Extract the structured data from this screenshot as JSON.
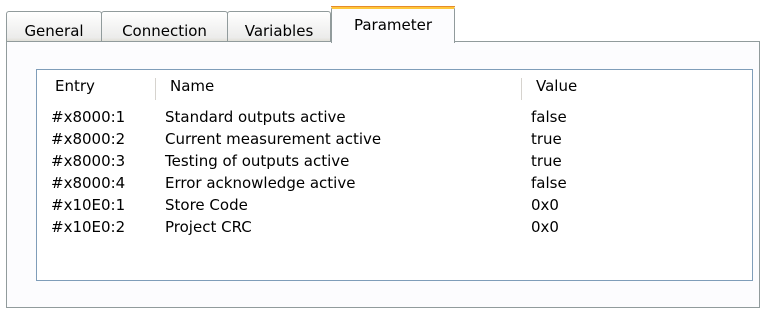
{
  "tabs": [
    {
      "label": "General",
      "active": false
    },
    {
      "label": "Connection",
      "active": false
    },
    {
      "label": "Variables",
      "active": false
    },
    {
      "label": "Parameter",
      "active": true
    }
  ],
  "list": {
    "columns": [
      "Entry",
      "Name",
      "Value"
    ],
    "rows": [
      {
        "entry": "#x8000:1",
        "name": "Standard outputs active",
        "value": "false"
      },
      {
        "entry": "#x8000:2",
        "name": "Current measurement active",
        "value": "true"
      },
      {
        "entry": "#x8000:3",
        "name": "Testing of outputs active",
        "value": "true"
      },
      {
        "entry": "#x8000:4",
        "name": "Error acknowledge active",
        "value": "false"
      },
      {
        "entry": "#x10E0:1",
        "name": "Store Code",
        "value": "0x0"
      },
      {
        "entry": "#x10E0:2",
        "name": "Project CRC",
        "value": "0x0"
      }
    ]
  },
  "colors": {
    "active_tab_accent": "#ffc83c",
    "border": "#919b9c",
    "list_border": "#7f9db9"
  }
}
